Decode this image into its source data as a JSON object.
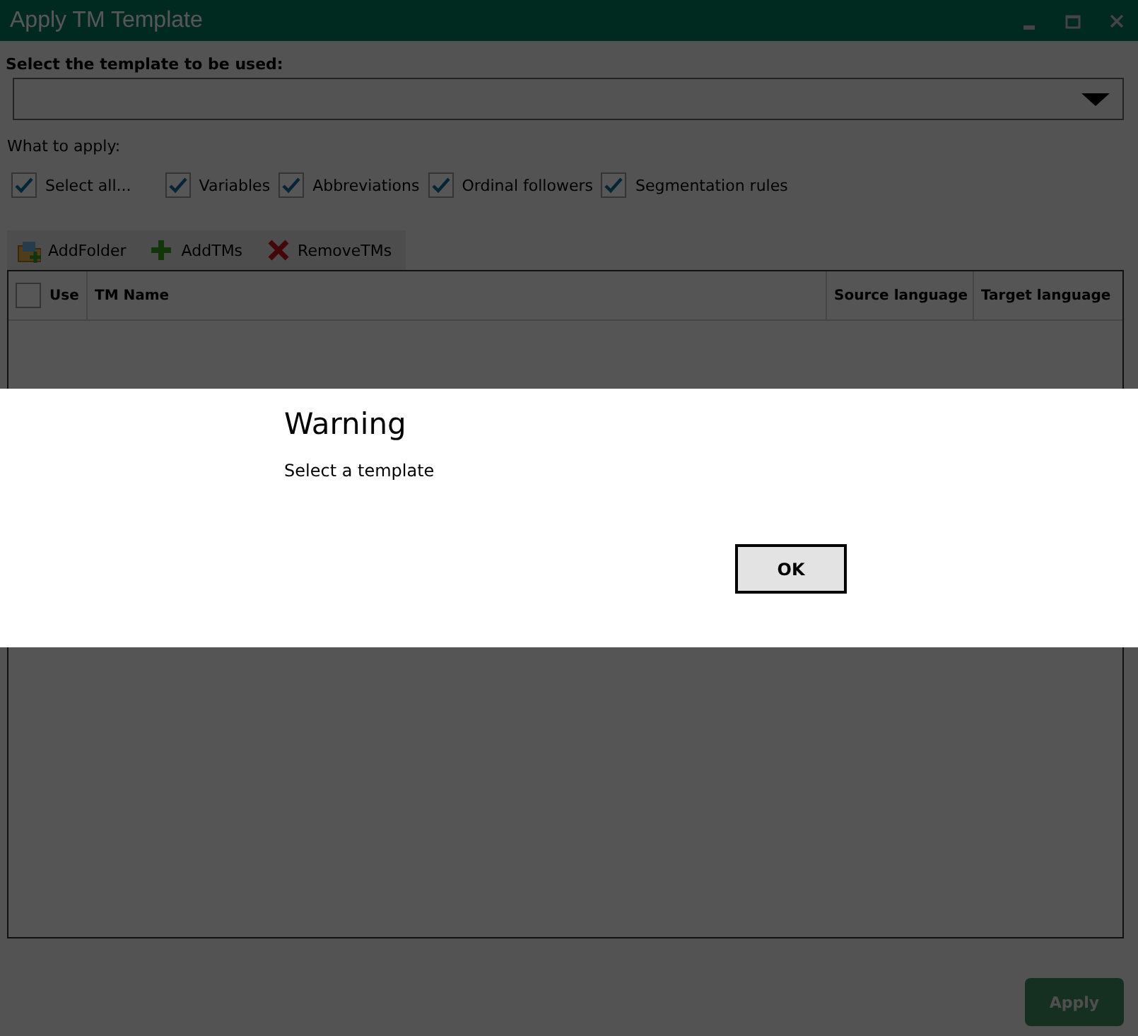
{
  "window": {
    "title": "Apply TM Template"
  },
  "template": {
    "label": "Select the template to be used:"
  },
  "apply_section": {
    "label": "What to apply:",
    "options": [
      {
        "label": "Select all...",
        "checked": true
      },
      {
        "label": "Variables",
        "checked": true
      },
      {
        "label": "Abbreviations",
        "checked": true
      },
      {
        "label": "Ordinal followers",
        "checked": true
      },
      {
        "label": "Segmentation rules",
        "checked": true
      }
    ]
  },
  "toolbar": [
    {
      "kind": "folder",
      "label": "AddFolder"
    },
    {
      "kind": "add",
      "label": "AddTMs"
    },
    {
      "kind": "remove",
      "label": "RemoveTMs"
    }
  ],
  "table": {
    "select_all_checked": false,
    "columns": [
      "Use",
      "TM Name",
      "Source language",
      "Target language"
    ]
  },
  "apply_button": {
    "label": "Apply",
    "disabled": true
  },
  "dialog": {
    "title": "Warning",
    "message": "Select a template",
    "button": "OK"
  }
}
